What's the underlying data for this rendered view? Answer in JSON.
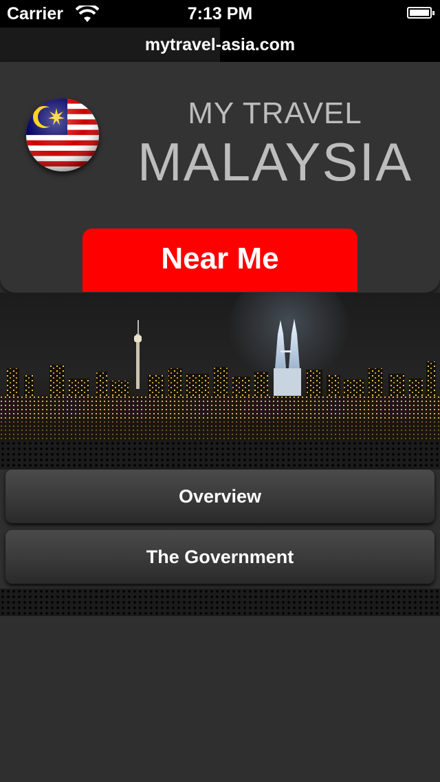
{
  "status_bar": {
    "carrier": "Carrier",
    "time": "7:13 PM"
  },
  "url_bar": {
    "url": "mytravel-asia.com"
  },
  "header": {
    "title_small": "MY TRAVEL",
    "title_big": "MALAYSIA",
    "near_me_label": "Near Me"
  },
  "menu": {
    "items": [
      {
        "label": "Overview"
      },
      {
        "label": "The Government"
      }
    ]
  },
  "colors": {
    "near_me_bg": "#ff0000",
    "panel_bg": "#333333",
    "title_text": "#bdbdbd"
  },
  "icons": {
    "flag": "malaysia-flag-icon",
    "wifi": "wifi-icon",
    "battery": "battery-icon"
  }
}
